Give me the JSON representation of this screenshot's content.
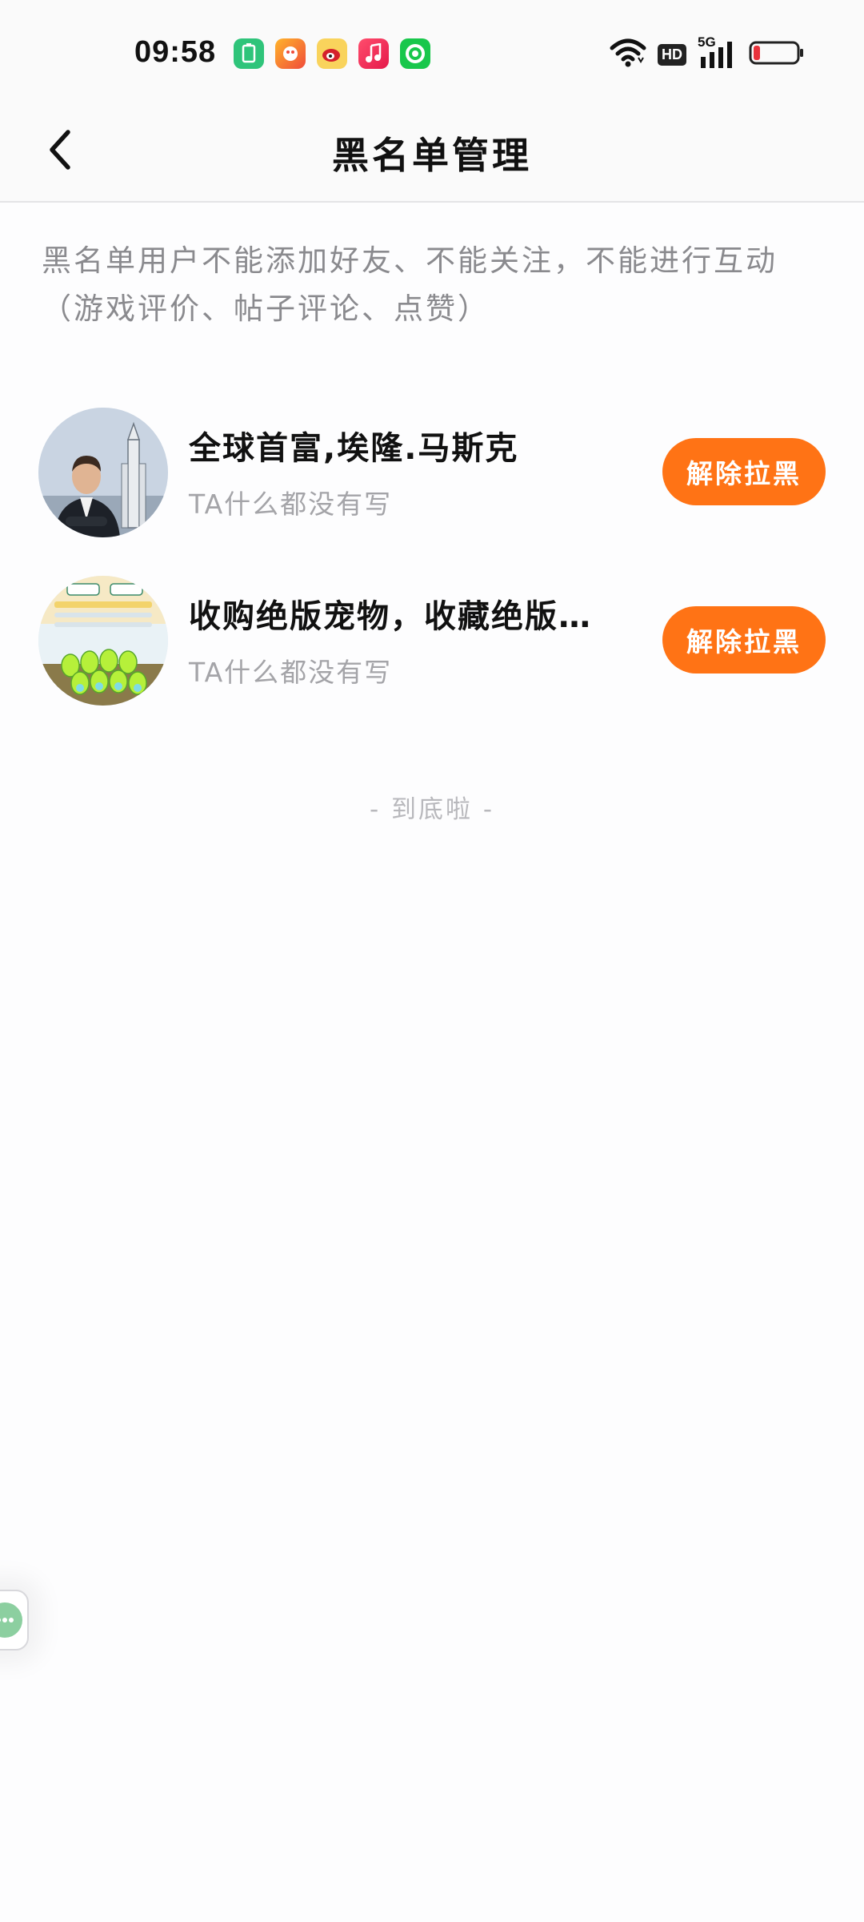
{
  "status_bar": {
    "time": "09:58",
    "apps": [
      {
        "name": "battery-app-icon",
        "glyph": "▯"
      },
      {
        "name": "game-app-icon",
        "glyph": "◉"
      },
      {
        "name": "weibo-app-icon",
        "glyph": "◎"
      },
      {
        "name": "music-app-icon",
        "glyph": "♪"
      },
      {
        "name": "camera-app-icon",
        "glyph": "○"
      }
    ],
    "hd_label": "HD",
    "network_label": "5G",
    "battery_level": 0.15,
    "battery_color": "#e8333c"
  },
  "nav": {
    "title": "黑名单管理"
  },
  "notice": {
    "text": "黑名单用户不能添加好友、不能关注，不能进行互动（游戏评价、帖子评论、点赞）"
  },
  "users": [
    {
      "name": "全球首富,埃隆.马斯克",
      "bio": "TA什么都没有写",
      "action": "解除拉黑"
    },
    {
      "name": "收购绝版宠物，收藏绝版宠...",
      "bio": "TA什么都没有写",
      "action": "解除拉黑"
    }
  ],
  "list_end": "- 到底啦 -",
  "colors": {
    "accent": "#ff7315",
    "background": "#fdfdfe",
    "muted_text": "#8a8a8e"
  }
}
